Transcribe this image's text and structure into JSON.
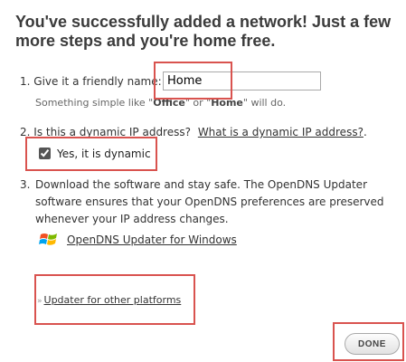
{
  "page": {
    "title": "You've successfully added a network! Just a few more steps and you're home free."
  },
  "step1": {
    "number": "1.",
    "label": "Give it a friendly name:",
    "input_value": "Home",
    "hint_prefix": "Something simple like \"",
    "hint_example1": "Office",
    "hint_middle": "\" or \"",
    "hint_example2": "Home",
    "hint_suffix": "\" will do."
  },
  "step2": {
    "number": "2.",
    "question": "Is this a dynamic IP address?",
    "help_link": "What is a dynamic IP address?",
    "help_link_suffix": ".",
    "checkbox_label": "Yes, it is dynamic",
    "checkbox_checked": true
  },
  "step3": {
    "number": "3.",
    "line1": "Download the software and stay safe. The OpenDNS Updater",
    "line2": "software ensures that your OpenDNS preferences are preserved",
    "line3": "whenever your IP address changes.",
    "windows_link": "OpenDNS Updater for Windows",
    "windows_icon": "windows-logo-icon",
    "other_chevron": "»",
    "other_link": "Updater for other platforms"
  },
  "done_button": {
    "label": "DONE"
  },
  "colors": {
    "highlight": "#d9534f",
    "text": "#333333",
    "title": "#3b3b3b"
  }
}
